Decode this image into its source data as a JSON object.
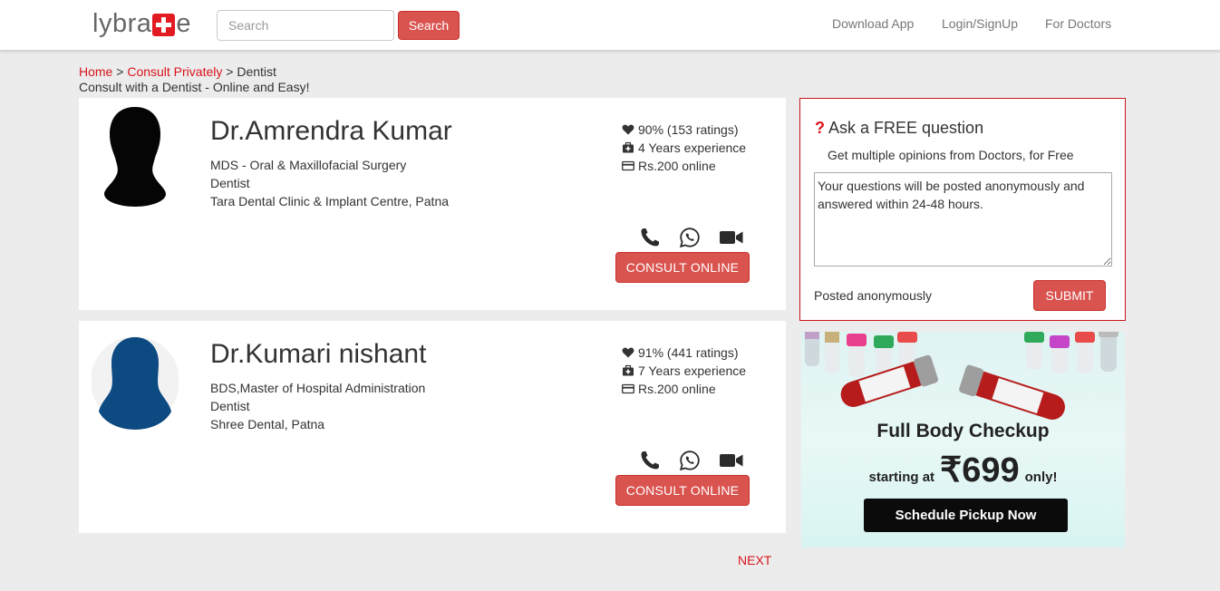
{
  "header": {
    "logo_left": "lybra",
    "logo_right": "e",
    "search_placeholder": "Search",
    "search_button": "Search",
    "nav": [
      "Download App",
      "Login/SignUp",
      "For Doctors"
    ]
  },
  "breadcrumb": {
    "home": "Home",
    "sep1": " > ",
    "consult": "Consult Privately",
    "sep2": " > Dentist",
    "subtitle": "Consult with a Dentist - Online and Easy!"
  },
  "doctors": [
    {
      "name": "Dr.Amrendra Kumar",
      "qualification": "MDS - Oral & Maxillofacial Surgery",
      "specialty": "Dentist",
      "clinic": "Tara Dental Clinic & Implant Centre, Patna",
      "rating": "90% (153 ratings)",
      "experience": "4 Years experience",
      "fee": "Rs.200 online",
      "consult_label": "CONSULT ONLINE"
    },
    {
      "name": "Dr.Kumari nishant",
      "qualification": "BDS,Master of Hospital Administration",
      "specialty": "Dentist",
      "clinic": "Shree Dental, Patna",
      "rating": "91% (441 ratings)",
      "experience": "7 Years experience",
      "fee": "Rs.200 online",
      "consult_label": "CONSULT ONLINE"
    }
  ],
  "ask": {
    "title": "Ask a FREE question",
    "subtitle": "Get multiple opinions from Doctors, for Free",
    "textarea_value": "Your questions will be posted anonymously and answered within 24-48 hours.",
    "posted": "Posted anonymously",
    "submit": "SUBMIT"
  },
  "banner": {
    "title": "Full Body Checkup",
    "starting": "starting at",
    "price": "₹699",
    "only": "only!",
    "cta": "Schedule Pickup Now"
  },
  "pagination": {
    "next": "NEXT"
  },
  "colors": {
    "accent": "#d9534f",
    "brand_red": "#d9141c",
    "avatar_female": "#0d4a82"
  }
}
